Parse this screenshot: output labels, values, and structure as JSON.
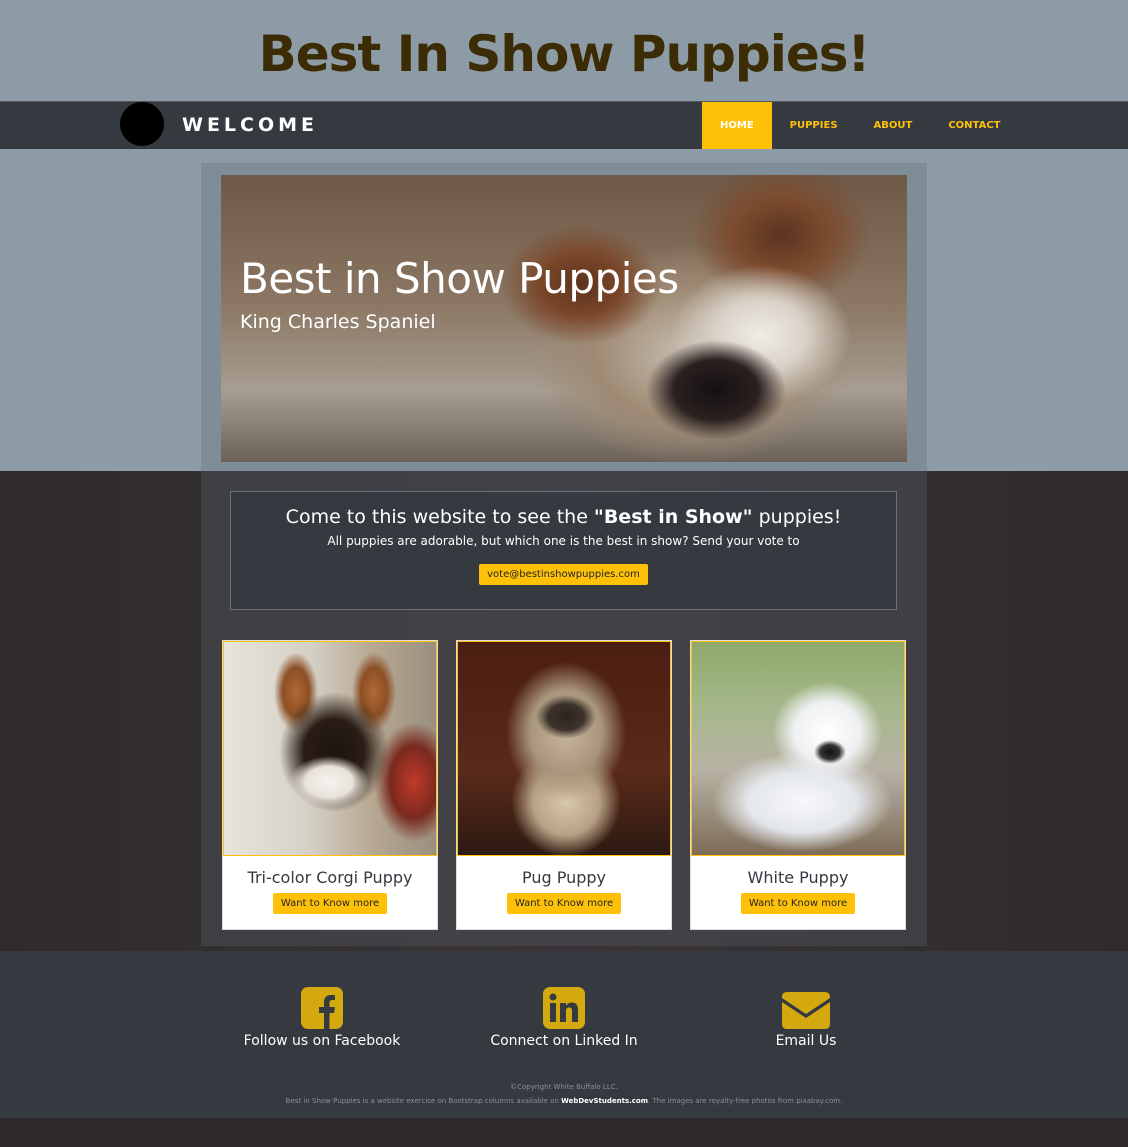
{
  "banner": {
    "title": "Best In Show Puppies!"
  },
  "nav": {
    "brand": "WELCOME",
    "items": [
      {
        "label": "HOME",
        "active": true
      },
      {
        "label": "PUPPIES"
      },
      {
        "label": "ABOUT"
      },
      {
        "label": "CONTACT"
      }
    ]
  },
  "hero": {
    "title": "Best in Show Puppies",
    "subtitle": "King Charles Spaniel"
  },
  "callout": {
    "title_pre": "Come to this website to see the ",
    "title_bold": "\"Best in Show\"",
    "title_post": " puppies!",
    "text": "All puppies are adorable, but which one is the best in show? Send your vote to",
    "button": "vote@bestinshowpuppies.com"
  },
  "cards": [
    {
      "title": "Tri-color Corgi Puppy",
      "button": "Want to Know more"
    },
    {
      "title": "Pug Puppy",
      "button": "Want to Know more"
    },
    {
      "title": "White Puppy",
      "button": "Want to Know more"
    }
  ],
  "footer": {
    "social": [
      {
        "label": "Follow us on Facebook",
        "icon": "facebook-icon"
      },
      {
        "label": "Connect on Linked In",
        "icon": "linkedin-icon"
      },
      {
        "label": "Email Us",
        "icon": "envelope-icon"
      }
    ],
    "copyright": "©Copyright White Buffalo LLC.",
    "credits_pre": "Best in Show Puppies is a website exercise on Bootstrap columns available on ",
    "credits_link": "WebDevStudents.com",
    "credits_post": ". The images are royalty-free photos from pixabay.com."
  },
  "colors": {
    "accent": "#ffc107",
    "nav_bg": "#343a40",
    "banner_bg": "#8d9ba6",
    "title": "#3b2c05"
  }
}
